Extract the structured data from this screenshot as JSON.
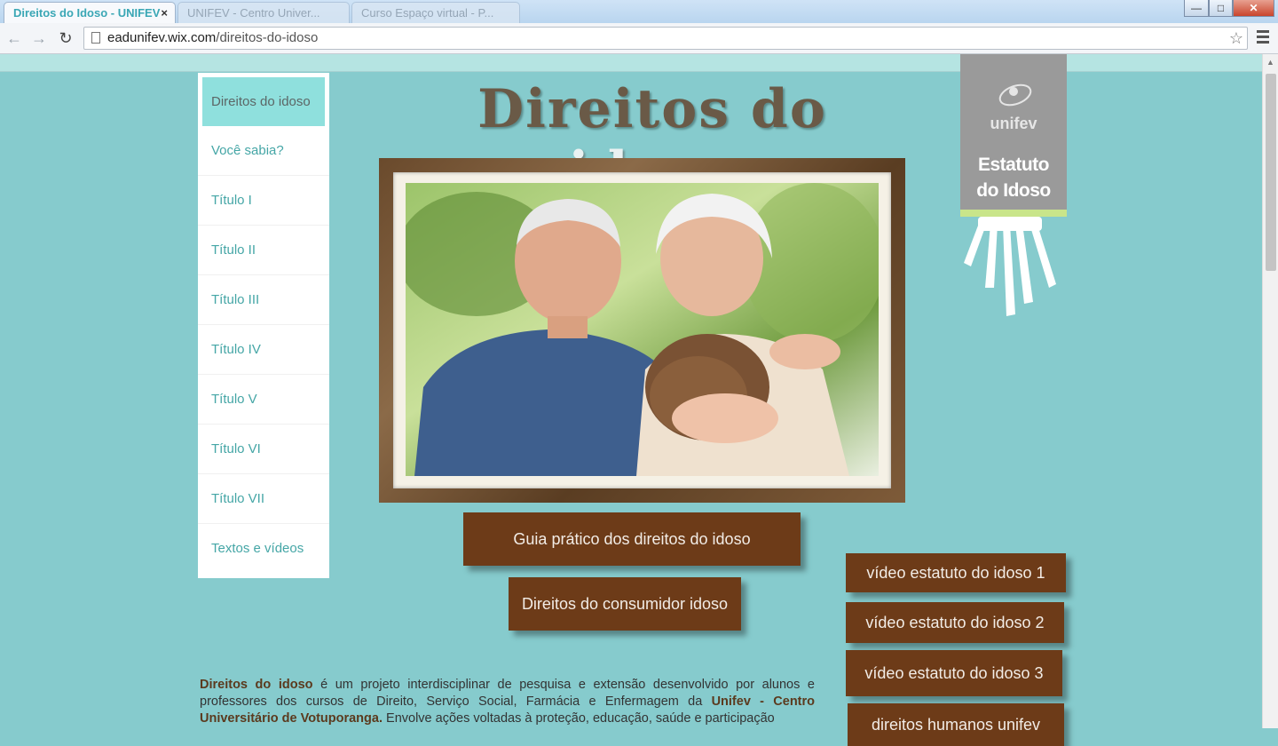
{
  "browser": {
    "active_tab": "Direitos do Idoso - UNIFEV",
    "inactive_tabs": [
      "UNIFEV - Centro Univer...",
      "Curso Espaço virtual - P..."
    ],
    "url_host": "eadunifev.wix.com",
    "url_path": "/direitos-do-idoso",
    "close_glyph": "×"
  },
  "nav": {
    "items": [
      {
        "label": "Direitos do idoso",
        "active": true
      },
      {
        "label": "Você sabia?"
      },
      {
        "label": "Título I"
      },
      {
        "label": "Título II"
      },
      {
        "label": "Título III"
      },
      {
        "label": "Título IV"
      },
      {
        "label": "Título V"
      },
      {
        "label": "Título VI"
      },
      {
        "label": "Título VII"
      },
      {
        "label": "Textos e vídeos"
      }
    ]
  },
  "header": {
    "title_dark": "Direitos do",
    "title_light": "idoso"
  },
  "logo": {
    "brand": "unifev",
    "line1": "Estatuto",
    "line2": "do Idoso"
  },
  "buttons": {
    "guia": "Guia prático dos direitos do idoso",
    "consumidor": "Direitos do consumidor idoso",
    "video1": "vídeo estatuto do idoso 1",
    "video2": "vídeo estatuto do idoso 2",
    "video3": "vídeo estatuto do idoso 3",
    "video4": "direitos humanos unifev"
  },
  "description": {
    "bold1": "Direitos do idoso",
    "text1": " é um projeto interdisciplinar de pesquisa e extensão desenvolvido por alunos e professores dos cursos de Direito, Serviço Social, Farmácia e Enfermagem da ",
    "bold2": "Unifev - Centro Universitário de Votuporanga.",
    "text2": " Envolve ações voltadas à proteção, educação, saúde e participação"
  },
  "colors": {
    "page_bg": "#86cbcd",
    "button_brown": "#6d3b18",
    "menu_active": "#8fe0dd",
    "menu_text": "#45a6a6"
  }
}
